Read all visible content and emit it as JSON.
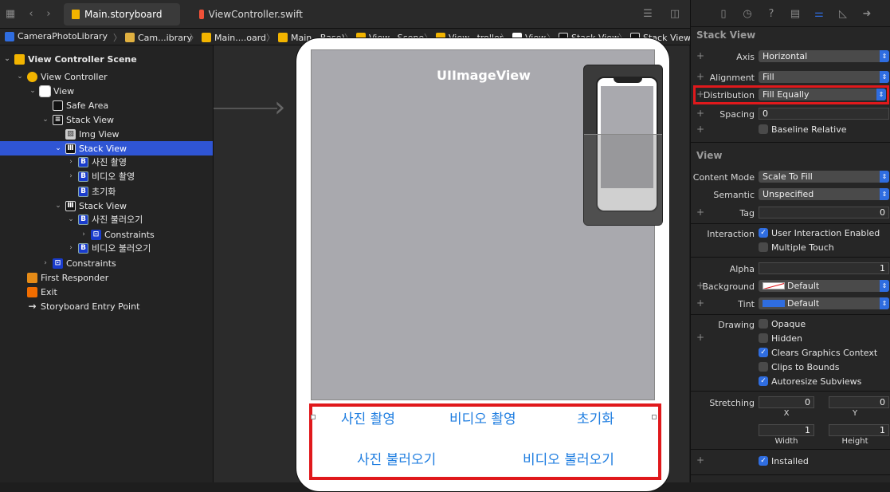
{
  "tabs": {
    "storyboard": "Main.storyboard",
    "swift": "ViewController.swift"
  },
  "breadcrumb": [
    "CameraPhotoLibrary",
    "Cam...ibrary",
    "Main....oard",
    "Main...Base)",
    "View...Scene",
    "View...troller",
    "View",
    "Stack View",
    "Stack View"
  ],
  "navigator": {
    "rows": [
      {
        "label": "View Controller Scene",
        "icon": "scene-icon"
      },
      {
        "label": "View Controller",
        "icon": "view-controller-icon"
      },
      {
        "label": "View",
        "icon": "view-icon"
      },
      {
        "label": "Safe Area",
        "icon": "safe-area-icon"
      },
      {
        "label": "Stack View",
        "icon": "stack-view-icon"
      },
      {
        "label": "Img View",
        "icon": "image-view-icon"
      },
      {
        "label": "Stack View",
        "icon": "stack-view-icon"
      },
      {
        "label": "사진 촬영",
        "icon": "button-icon"
      },
      {
        "label": "비디오 촬영",
        "icon": "button-icon"
      },
      {
        "label": "초기화",
        "icon": "button-icon"
      },
      {
        "label": "Stack View",
        "icon": "stack-view-icon"
      },
      {
        "label": "사진 불러오기",
        "icon": "button-icon"
      },
      {
        "label": "Constraints",
        "icon": "constraints-icon"
      },
      {
        "label": "비디오 불러오기",
        "icon": "button-icon"
      },
      {
        "label": "Constraints",
        "icon": "constraints-icon"
      },
      {
        "label": "First Responder",
        "icon": "first-responder-icon"
      },
      {
        "label": "Exit",
        "icon": "exit-icon"
      },
      {
        "label": "Storyboard Entry Point",
        "icon": "entry-point-icon"
      }
    ]
  },
  "canvas": {
    "image_view_label": "UIImageView",
    "buttons_row1": [
      "사진 촬영",
      "비디오 촬영",
      "초기화"
    ],
    "buttons_row2": [
      "사진 불러오기",
      "비디오 불러오기"
    ]
  },
  "inspector": {
    "stack_view_header": "Stack View",
    "axis_label": "Axis",
    "axis_value": "Horizontal",
    "alignment_label": "Alignment",
    "alignment_value": "Fill",
    "distribution_label": "Distribution",
    "distribution_value": "Fill Equally",
    "spacing_label": "Spacing",
    "spacing_value": "0",
    "baseline_label": "Baseline Relative",
    "view_header": "View",
    "content_mode_label": "Content Mode",
    "content_mode_value": "Scale To Fill",
    "semantic_label": "Semantic",
    "semantic_value": "Unspecified",
    "tag_label": "Tag",
    "tag_value": "0",
    "interaction_label": "Interaction",
    "user_interaction": "User Interaction Enabled",
    "multiple_touch": "Multiple Touch",
    "alpha_label": "Alpha",
    "alpha_value": "1",
    "background_label": "Background",
    "background_value": "Default",
    "tint_label": "Tint",
    "tint_value": "Default",
    "drawing_label": "Drawing",
    "opaque": "Opaque",
    "hidden": "Hidden",
    "clears": "Clears Graphics Context",
    "clips": "Clips to Bounds",
    "autoresize": "Autoresize Subviews",
    "stretching_label": "Stretching",
    "stretch_x": "0",
    "stretch_y": "0",
    "x_label": "X",
    "y_label": "Y",
    "stretch_w": "1",
    "stretch_h": "1",
    "width_label": "Width",
    "height_label": "Height",
    "installed": "Installed"
  },
  "colors": {
    "accent": "#2f6de0",
    "selection": "#2f55d4",
    "highlight": "#e0191c",
    "button_text": "#1e7de0"
  }
}
